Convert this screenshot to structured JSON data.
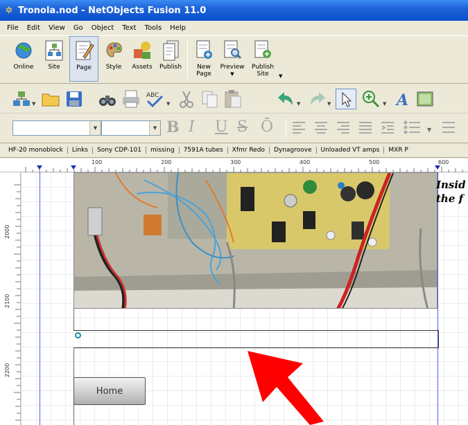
{
  "window": {
    "title": "Tronola.nod - NetObjects Fusion 11.0"
  },
  "menu": [
    "File",
    "Edit",
    "View",
    "Go",
    "Object",
    "Text",
    "Tools",
    "Help"
  ],
  "main_toolbar": [
    {
      "label": "Online"
    },
    {
      "label": "Site"
    },
    {
      "label": "Page"
    },
    {
      "label": "Style"
    },
    {
      "label": "Assets"
    },
    {
      "label": "Publish"
    },
    {
      "label": "New Page"
    },
    {
      "label": "Preview"
    },
    {
      "label": "Publish Site"
    }
  ],
  "format_toolbar": {
    "bold": "B",
    "italic": "I",
    "underline": "U",
    "strike": "S",
    "overline": "Ō"
  },
  "page_tabs": [
    "HF-20 monoblock",
    "Links",
    "Sony CDP-101",
    "missing",
    "7591A tubes",
    "Xfmr Redo",
    "Dynagroove",
    "Unloaded VT amps",
    "MXR P"
  ],
  "ruler": {
    "h_labels": [
      "100",
      "200",
      "300",
      "400",
      "500",
      "600"
    ],
    "v_labels": [
      "2000",
      "2100",
      "2200"
    ]
  },
  "canvas": {
    "side_text_line1": "Insid",
    "side_text_line2": "the f",
    "home_button": "Home"
  },
  "colors": {
    "titlebar": "#0a4fcb",
    "guide": "#4a5fd8",
    "arrow": "#ff0000"
  }
}
